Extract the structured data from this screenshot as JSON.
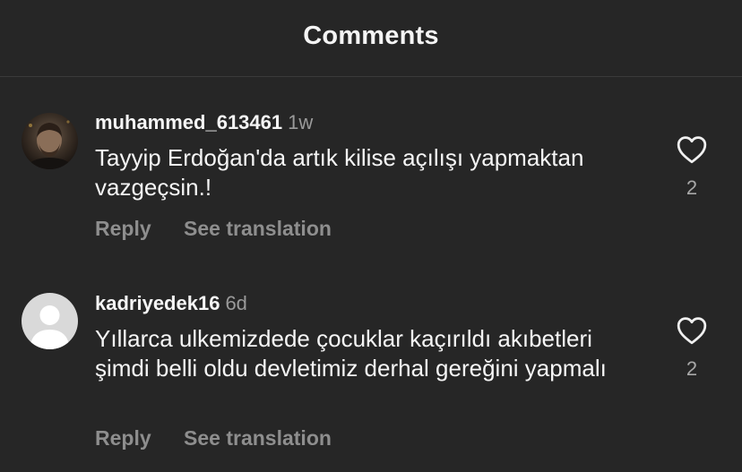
{
  "header": {
    "title": "Comments"
  },
  "comments": [
    {
      "username": "muhammed_613461",
      "time": "1w",
      "text": "Tayyip Erdoğan'da artık kilise açılışı yapmaktan vazgeçsin.!",
      "reply_label": "Reply",
      "translate_label": "See translation",
      "likes": "2",
      "avatar": "user-photo-avatar",
      "like_icon": "heart-outline-icon"
    },
    {
      "username": "kadriyedek16",
      "time": "6d",
      "text": "Yıllarca ulkemizdede çocuklar kaçırıldı akıbetleri şimdi belli oldu devletimiz derhal gereğini yapmalı",
      "reply_label": "Reply",
      "translate_label": "See translation",
      "likes": "2",
      "avatar": "default-avatar",
      "like_icon": "heart-outline-icon"
    }
  ],
  "colors": {
    "background": "#262626",
    "primary_text": "#f5f5f5",
    "secondary_text": "#8e8e8e"
  }
}
